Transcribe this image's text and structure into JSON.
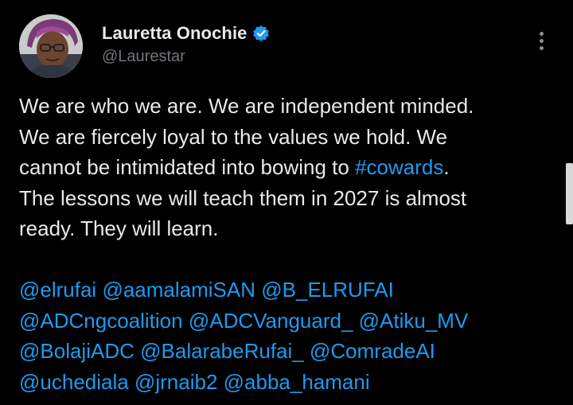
{
  "author": {
    "display_name": "Lauretta Onochie",
    "handle": "@Laurestar",
    "verified": true,
    "avatar_icon": "profile-photo"
  },
  "tweet": {
    "lines": [
      [
        {
          "text": "We are who we are. We are independent minded."
        }
      ],
      [
        {
          "text": "We are fiercely loyal to the values we hold. We"
        }
      ],
      [
        {
          "text": "cannot be intimidated into bowing to "
        },
        {
          "text": "#cowards",
          "link": true
        },
        {
          "text": "."
        }
      ],
      [
        {
          "text": "The lessons we will teach them in 2027 is almost"
        }
      ],
      [
        {
          "text": "ready. They will learn."
        }
      ],
      [],
      [
        {
          "text": "@elrufai",
          "link": true
        },
        {
          "text": " "
        },
        {
          "text": "@aamalamiSAN",
          "link": true
        },
        {
          "text": " "
        },
        {
          "text": "@B_ELRUFAI",
          "link": true
        }
      ],
      [
        {
          "text": "@ADCngcoalition",
          "link": true
        },
        {
          "text": " "
        },
        {
          "text": "@ADCVanguard_",
          "link": true
        },
        {
          "text": " "
        },
        {
          "text": "@Atiku_MV",
          "link": true
        }
      ],
      [
        {
          "text": "@BolajiADC",
          "link": true
        },
        {
          "text": " "
        },
        {
          "text": "@BalarabeRufai_",
          "link": true
        },
        {
          "text": " "
        },
        {
          "text": "@ComradeAI",
          "link": true
        }
      ],
      [
        {
          "text": "@uchediala",
          "link": true
        },
        {
          "text": " "
        },
        {
          "text": "@jrnaib2",
          "link": true
        },
        {
          "text": " "
        },
        {
          "text": "@abba_hamani",
          "link": true
        }
      ]
    ]
  },
  "menu": {
    "icon": "more-vertical-icon"
  },
  "colors": {
    "background": "#000000",
    "text": "#e7e9ea",
    "secondary_text": "#71767b",
    "link": "#1d9bf0",
    "verified_badge": "#1d9bf0"
  }
}
